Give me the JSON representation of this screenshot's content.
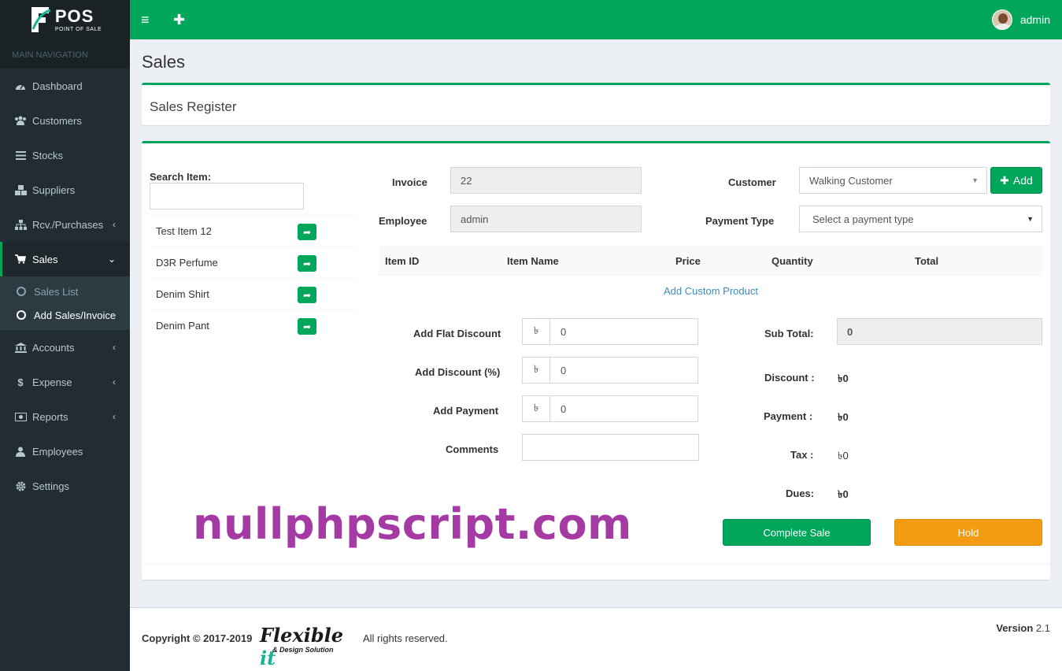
{
  "app": {
    "logo_title": "POS",
    "logo_subtitle": "POINT OF SALE",
    "nav_header": "MAIN NAVIGATION",
    "user_name": "admin"
  },
  "sidebar": {
    "items": [
      {
        "label": "Dashboard",
        "icon": "dashboard-icon"
      },
      {
        "label": "Customers",
        "icon": "users-icon"
      },
      {
        "label": "Stocks",
        "icon": "list-icon"
      },
      {
        "label": "Suppliers",
        "icon": "cubes-icon"
      },
      {
        "label": "Rcv./Purchases",
        "icon": "sitemap-icon"
      },
      {
        "label": "Sales",
        "icon": "cart-icon"
      },
      {
        "label": "Accounts",
        "icon": "bank-icon"
      },
      {
        "label": "Expense",
        "icon": "dollar-icon"
      },
      {
        "label": "Reports",
        "icon": "money-icon"
      },
      {
        "label": "Employees",
        "icon": "user-icon"
      },
      {
        "label": "Settings",
        "icon": "gear-icon"
      }
    ],
    "sales_sub": [
      "Sales List",
      "Add Sales/Invoice"
    ]
  },
  "page": {
    "title": "Sales",
    "box_title": "Sales Register"
  },
  "search": {
    "label": "Search Item:",
    "value": "",
    "items": [
      "Test Item 12",
      "D3R Perfume",
      "Denim Shirt",
      "Denim Pant"
    ]
  },
  "form": {
    "invoice_label": "Invoice",
    "invoice_value": "22",
    "employee_label": "Employee",
    "employee_value": "admin",
    "customer_label": "Customer",
    "customer_value": "Walking Customer",
    "add_label": "Add",
    "payment_type_label": "Payment Type",
    "payment_type_placeholder": "Select a payment type"
  },
  "table": {
    "headers": [
      "Item ID",
      "Item Name",
      "Price",
      "Quantity",
      "Total"
    ],
    "custom_link": "Add Custom Product"
  },
  "discounts": {
    "currency": "৳",
    "flat_label": "Add Flat Discount",
    "flat_value": "0",
    "pct_label": "Add Discount (%)",
    "pct_value": "0",
    "payment_label": "Add Payment",
    "payment_value": "0",
    "comments_label": "Comments",
    "comments_value": ""
  },
  "summary": {
    "subtotal_label": "Sub Total:",
    "subtotal_value": "0",
    "discount_label": "Discount :",
    "discount_value": "৳0",
    "payment_label": "Payment :",
    "payment_value": "৳0",
    "tax_label": "Tax :",
    "tax_value": "৳0",
    "dues_label": "Dues:",
    "dues_value": "৳0"
  },
  "actions": {
    "complete": "Complete Sale",
    "hold": "Hold"
  },
  "watermark": "nullphpscript.com",
  "footer": {
    "copyright": "Copyright © 2017-2019",
    "company_logo_text": "Flexible",
    "company_logo_accent": "it",
    "company_logo_sub": "& Design Solution",
    "rights": "All rights reserved.",
    "version_label": "Version",
    "version_value": "2.1"
  },
  "colors": {
    "accent": "#00a65a",
    "sidebar": "#222d32",
    "hold": "#f39c12",
    "link": "#3c8dbc",
    "watermark": "#a53aa4"
  }
}
